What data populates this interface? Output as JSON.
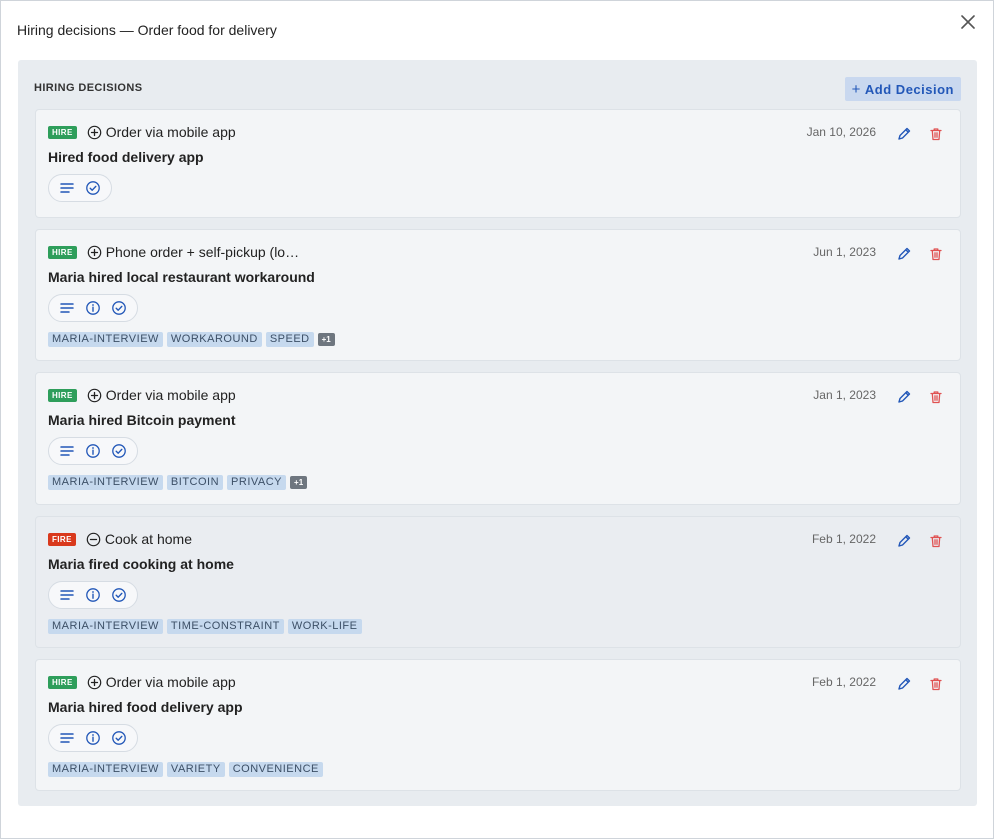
{
  "modal": {
    "title": "Hiring decisions — Order food for delivery"
  },
  "panel": {
    "heading": "HIRING DECISIONS",
    "add_button_label": "Add Decision",
    "add_button_plus": "+"
  },
  "colors": {
    "hire": "#2e9e5b",
    "fire": "#d9391c",
    "accent": "#2257b8",
    "delete": "#e05252"
  },
  "decisions": [
    {
      "type": "HIRE",
      "job": "Order via mobile app",
      "title": "Hired food delivery app",
      "date": "Jan 10, 2026",
      "icons": [
        "notes-icon",
        "check-circle-icon"
      ],
      "tags": [],
      "more": ""
    },
    {
      "type": "HIRE",
      "job": "Phone order + self-pickup (lo…",
      "title": "Maria hired local restaurant workaround",
      "date": "Jun 1, 2023",
      "icons": [
        "notes-icon",
        "info-icon",
        "check-circle-icon"
      ],
      "tags": [
        "MARIA-INTERVIEW",
        "WORKAROUND",
        "SPEED"
      ],
      "more": "+1"
    },
    {
      "type": "HIRE",
      "job": "Order via mobile app",
      "title": "Maria hired Bitcoin payment",
      "date": "Jan 1, 2023",
      "icons": [
        "notes-icon",
        "info-icon",
        "check-circle-icon"
      ],
      "tags": [
        "MARIA-INTERVIEW",
        "BITCOIN",
        "PRIVACY"
      ],
      "more": "+1"
    },
    {
      "type": "FIRE",
      "job": "Cook at home",
      "title": "Maria fired cooking at home",
      "date": "Feb 1, 2022",
      "icons": [
        "notes-icon",
        "info-icon",
        "check-circle-icon"
      ],
      "tags": [
        "MARIA-INTERVIEW",
        "TIME-CONSTRAINT",
        "WORK-LIFE"
      ],
      "more": ""
    },
    {
      "type": "HIRE",
      "job": "Order via mobile app",
      "title": "Maria hired food delivery app",
      "date": "Feb 1, 2022",
      "icons": [
        "notes-icon",
        "info-icon",
        "check-circle-icon"
      ],
      "tags": [
        "MARIA-INTERVIEW",
        "VARIETY",
        "CONVENIENCE"
      ],
      "more": ""
    }
  ]
}
